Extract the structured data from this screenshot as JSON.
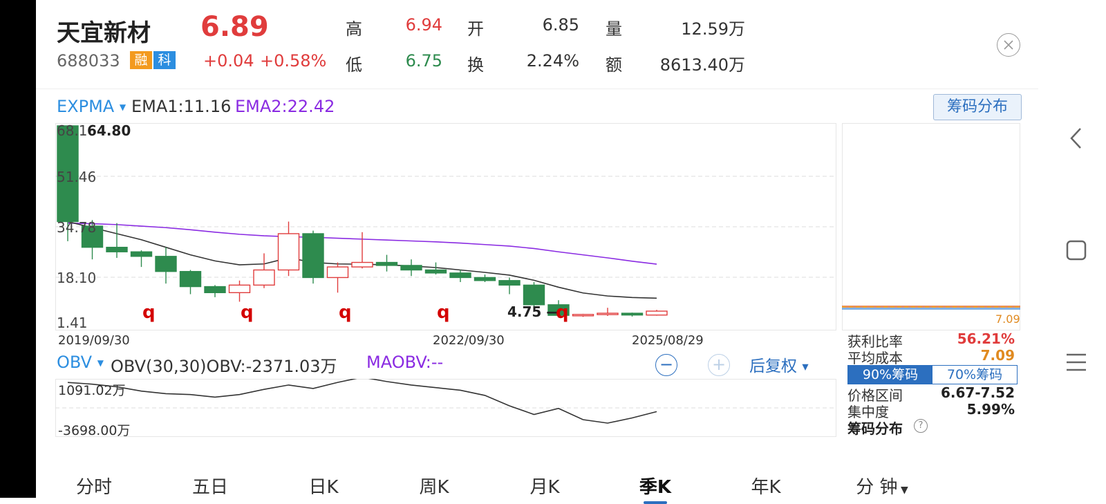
{
  "stock": {
    "name": "天宜新材",
    "price": "6.89",
    "code": "688033",
    "tag_rong": "融",
    "tag_ke": "科",
    "change": "+0.04",
    "change_pct": "+0.58%"
  },
  "quote": {
    "high_label": "高",
    "high": "6.94",
    "open_label": "开",
    "open": "6.85",
    "volume_label": "量",
    "volume": "12.59万",
    "low_label": "低",
    "low": "6.75",
    "turnover_label": "换",
    "turnover": "2.24%",
    "amount_label": "额",
    "amount": "8613.40万"
  },
  "main_indicator": {
    "name": "EXPMA",
    "ema1": "EMA1:11.16",
    "ema2": "EMA2:22.42"
  },
  "price_axis": {
    "labels": [
      "68.16",
      "51.46",
      "34.78",
      "18.10",
      "1.41"
    ],
    "max_label": "64.80",
    "min_label": "4.75"
  },
  "date_axis": [
    "2019/09/30",
    "2022/09/30",
    "2025/08/29"
  ],
  "q_markers": [
    "q",
    "q",
    "q",
    "q",
    "q"
  ],
  "sub_indicator": {
    "name": "OBV",
    "params": "OBV(30,30)OBV:-2371.03万",
    "maobv": "MAOBV:--",
    "top_label": "1091.02万",
    "bottom_label": "-3698.00万"
  },
  "controls": {
    "adjust": "后复权",
    "zoom_out": "−",
    "zoom_in": "+"
  },
  "chip": {
    "button": "筹码分布",
    "cost_label": "7.09",
    "profit_label": "获利比率",
    "profit": "56.21%",
    "avg_cost_label": "平均成本",
    "avg_cost": "7.09",
    "tab_90": "90%筹码",
    "tab_70": "70%筹码",
    "range_label": "价格区间",
    "range": "6.67-7.52",
    "concentration_label": "集中度",
    "concentration": "5.99%",
    "footer": "筹码分布",
    "help": "?"
  },
  "tabs": [
    "分时",
    "五日",
    "日K",
    "周K",
    "月K",
    "季K",
    "年K",
    "分 钟"
  ],
  "active_tab": "季K",
  "colors": {
    "up": "#e03c3c",
    "down": "#2e8b4e",
    "ema1": "#333333",
    "ema2": "#8a2be2",
    "accent": "#2c6fbf"
  },
  "chart_data": {
    "type": "candlestick",
    "x": [
      "2019Q3",
      "2019Q4",
      "2020Q1",
      "2020Q2",
      "2020Q3",
      "2020Q4",
      "2021Q1",
      "2021Q2",
      "2021Q3",
      "2021Q4",
      "2022Q1",
      "2022Q2",
      "2022Q3",
      "2022Q4",
      "2023Q1",
      "2023Q2",
      "2023Q3",
      "2023Q4",
      "2024Q1",
      "2024Q2",
      "2024Q3",
      "2024Q4",
      "2025Q1",
      "2025Q2",
      "2025Q3"
    ],
    "ohlc": [
      [
        68.16,
        68.16,
        30.0,
        36.5
      ],
      [
        35.0,
        37.0,
        24.0,
        28.0
      ],
      [
        28.0,
        36.0,
        24.5,
        26.5
      ],
      [
        26.5,
        27.0,
        21.5,
        25.0
      ],
      [
        25.0,
        28.0,
        16.0,
        20.0
      ],
      [
        20.0,
        20.5,
        12.5,
        15.0
      ],
      [
        15.0,
        15.5,
        11.5,
        13.0
      ],
      [
        13.0,
        17.0,
        10.0,
        15.5
      ],
      [
        15.5,
        26.0,
        14.5,
        20.5
      ],
      [
        20.5,
        36.5,
        18.5,
        32.5
      ],
      [
        32.5,
        33.5,
        16.0,
        18.0
      ],
      [
        18.0,
        23.0,
        13.0,
        21.5
      ],
      [
        21.5,
        33.0,
        21.0,
        23.0
      ],
      [
        23.0,
        25.5,
        20.0,
        22.0
      ],
      [
        22.0,
        24.0,
        18.5,
        20.5
      ],
      [
        20.5,
        23.0,
        19.0,
        19.5
      ],
      [
        19.5,
        20.5,
        16.5,
        18.0
      ],
      [
        18.0,
        19.0,
        16.5,
        17.0
      ],
      [
        17.0,
        18.0,
        12.5,
        15.5
      ],
      [
        15.5,
        16.5,
        8.5,
        9.0
      ],
      [
        9.0,
        10.5,
        4.75,
        5.5
      ],
      [
        5.5,
        6.0,
        5.0,
        5.8
      ],
      [
        5.8,
        8.0,
        5.3,
        6.2
      ],
      [
        6.2,
        6.4,
        5.1,
        5.6
      ],
      [
        5.6,
        7.3,
        5.4,
        6.89
      ]
    ],
    "ema1": [
      36.5,
      34.5,
      32.5,
      30.5,
      28.0,
      25.5,
      23.5,
      22.2,
      22.5,
      24.5,
      23.0,
      22.5,
      22.4,
      22.2,
      21.8,
      21.3,
      20.5,
      19.7,
      18.8,
      17.1,
      14.8,
      12.9,
      11.9,
      11.4,
      11.16
    ],
    "ema2": [
      36.0,
      35.8,
      35.5,
      35.0,
      34.5,
      33.8,
      33.0,
      32.3,
      31.8,
      31.5,
      31.3,
      31.0,
      30.7,
      30.4,
      30.1,
      29.8,
      29.4,
      28.9,
      28.4,
      27.6,
      26.5,
      25.5,
      24.5,
      23.4,
      22.42
    ],
    "obv": [
      1000,
      800,
      500,
      0,
      -300,
      -400,
      -700,
      -400,
      200,
      700,
      300,
      1000,
      1600,
      1100,
      700,
      400,
      100,
      -500,
      -1700,
      -2700,
      -2000,
      -3300,
      -3698,
      -3100,
      -2371.03
    ],
    "price_range": [
      1.41,
      68.16
    ],
    "obv_range": [
      -3698,
      1091.02
    ]
  }
}
